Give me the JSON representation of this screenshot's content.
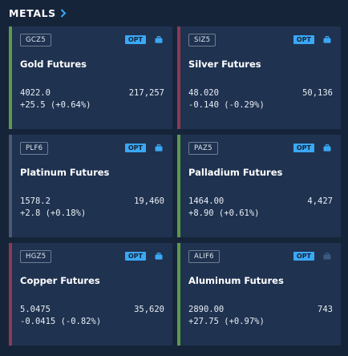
{
  "header": {
    "title": "METALS"
  },
  "cards": [
    {
      "code": "GCZ5",
      "opt": "OPT",
      "name": "Gold Futures",
      "price": "4022.0",
      "volume": "217,257",
      "change": "+25.5 (+0.64%)",
      "trend": "up",
      "briefcase_active": true
    },
    {
      "code": "SIZ5",
      "opt": "OPT",
      "name": "Silver Futures",
      "price": "48.020",
      "volume": "50,136",
      "change": "-0.140 (-0.29%)",
      "trend": "down",
      "briefcase_active": true
    },
    {
      "code": "PLF6",
      "opt": "OPT",
      "name": "Platinum Futures",
      "price": "1578.2",
      "volume": "19,460",
      "change": "+2.8 (+0.18%)",
      "trend": "flat",
      "briefcase_active": true
    },
    {
      "code": "PAZ5",
      "opt": "OPT",
      "name": "Palladium Futures",
      "price": "1464.00",
      "volume": "4,427",
      "change": "+8.90 (+0.61%)",
      "trend": "up",
      "briefcase_active": true
    },
    {
      "code": "HGZ5",
      "opt": "OPT",
      "name": "Copper Futures",
      "price": "5.0475",
      "volume": "35,620",
      "change": "-0.0415 (-0.82%)",
      "trend": "down",
      "briefcase_active": true
    },
    {
      "code": "ALIF6",
      "opt": "OPT",
      "name": "Aluminum Futures",
      "price": "2890.00",
      "volume": "743",
      "change": "+27.75 (+0.97%)",
      "trend": "up",
      "briefcase_active": false
    }
  ],
  "colors": {
    "up": "#5a9a4a",
    "down": "#8c3a52",
    "flat": "#4b5a71",
    "accent": "#3aa8f5",
    "briefcase_inactive": "#3b5a80"
  }
}
